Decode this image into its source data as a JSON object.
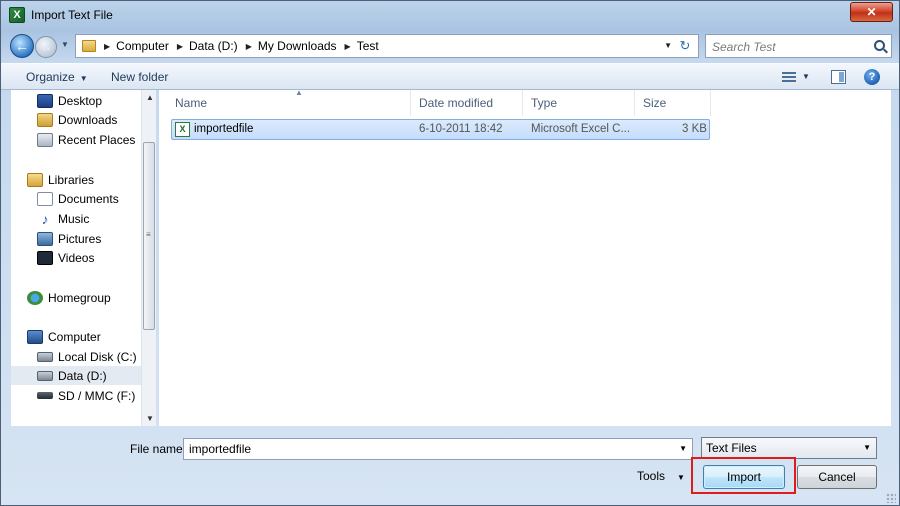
{
  "window": {
    "title": "Import Text File",
    "app_icon_letter": "X",
    "close_glyph": "✕"
  },
  "address": {
    "breadcrumbs": [
      "Computer",
      "Data (D:)",
      "My Downloads",
      "Test"
    ],
    "search_placeholder": "Search Test"
  },
  "toolbar": {
    "organize_label": "Organize",
    "new_folder_label": "New folder",
    "help_glyph": "?"
  },
  "navpane": {
    "items": [
      {
        "label": "Desktop",
        "icon": "desktop-icon"
      },
      {
        "label": "Downloads",
        "icon": "downloads-folder-icon"
      },
      {
        "label": "Recent Places",
        "icon": "recent-places-icon"
      },
      {
        "label": "Libraries",
        "icon": "libraries-icon"
      },
      {
        "label": "Documents",
        "icon": "documents-icon"
      },
      {
        "label": "Music",
        "icon": "music-icon"
      },
      {
        "label": "Pictures",
        "icon": "pictures-icon"
      },
      {
        "label": "Videos",
        "icon": "videos-icon"
      },
      {
        "label": "Homegroup",
        "icon": "homegroup-icon"
      },
      {
        "label": "Computer",
        "icon": "computer-icon"
      },
      {
        "label": "Local Disk (C:)",
        "icon": "local-disk-icon"
      },
      {
        "label": "Data (D:)",
        "icon": "drive-icon",
        "selected": true
      },
      {
        "label": "SD / MMC (F:)",
        "icon": "sd-card-icon"
      }
    ]
  },
  "filelist": {
    "columns": [
      "Name",
      "Date modified",
      "Type",
      "Size"
    ],
    "rows": [
      {
        "name": "importedfile",
        "date_modified": "6-10-2011 18:42",
        "type": "Microsoft Excel C...",
        "size": "3 KB",
        "selected": true
      }
    ]
  },
  "footer": {
    "file_name_label": "File name:",
    "file_name_value": "importedfile",
    "file_type_value": "Text Files",
    "tools_label": "Tools",
    "import_label": "Import",
    "cancel_label": "Cancel"
  },
  "colors": {
    "highlight": "#e01b1b",
    "selection": "#c4ddfc",
    "close_button": "#c0301a"
  }
}
